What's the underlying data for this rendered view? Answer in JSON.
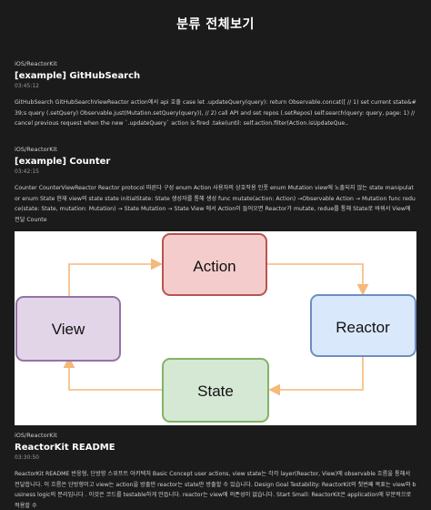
{
  "page": {
    "title": "분류 전체보기"
  },
  "posts": [
    {
      "category": "iOS/ReactorKit",
      "title": "[example] GitHubSearch",
      "date": "03:45:12",
      "excerpt": "GitHubSearch GitHubSearchViewReactor action에서 api 호출 case let .updateQuery(query): return Observable.concat([ // 1) set current state&#39;s query (.setQuery) Observable.just(Mutation.setQuery(query)), // 2) call API and set repos (.setRepos) self.search(query: query, page: 1) // cancel previous request when the new `.updateQuery` action is fired .take(until: self.action.filter(Action.isUpdateQue.."
    },
    {
      "category": "iOS/ReactorKit",
      "title": "[example] Counter",
      "date": "03:42:15",
      "excerpt": "Counter CounterViewReactor Reactor protocol 따른다 구성 enum Action 사용자의 상호작용 인풋 enum Mutation view에 노출되지 않는 state manipulator enum State 현재 view의 state state initialState: State 생성자를 통해 생성 func mutate(action: Action) →Observable Action → Mutation func reduce(state: State, mutation: Mutation) → State Mutation → State View 에서 Action이 들어오면 Reactor가 mutate, redue를 통해 State로 바꿔서 View에 전달 Counte"
    },
    {
      "category": "iOS/ReactorKit",
      "title": "ReactorKit README",
      "date": "03:30:50",
      "excerpt": "ReactorKit README 반응형, 단방향 스위프트 아키텍처 Basic Concept user actions, view state는 각각 layer(Reactor, View)에 observable 흐름을 통해서 전달합니다. 이 흐름은 단방향이고 view는 action을 방출만 reactor는 state만 방출할 수 있습니다. Design Goal Testability: ReactorKit의 첫번째 목표는 view와 business logic의 분리입니다 . 이것은 코드를 testable하게 만듭니다. reactor는 view에 의존성이 없습니다. Start Small: ReactorKit은 application에 부분적으로 적용할 수"
    }
  ],
  "diagram": {
    "action_label": "Action",
    "view_label": "View",
    "reactor_label": "Reactor",
    "state_label": "State",
    "colors": {
      "action_fill": "#f4cccc",
      "action_stroke": "#b85450",
      "view_fill": "#e1d5e7",
      "view_stroke": "#9673a6",
      "reactor_fill": "#dae8fc",
      "reactor_stroke": "#6c8ebf",
      "state_fill": "#d5e8d4",
      "state_stroke": "#82b366",
      "arrow": "#f5b97a"
    }
  }
}
